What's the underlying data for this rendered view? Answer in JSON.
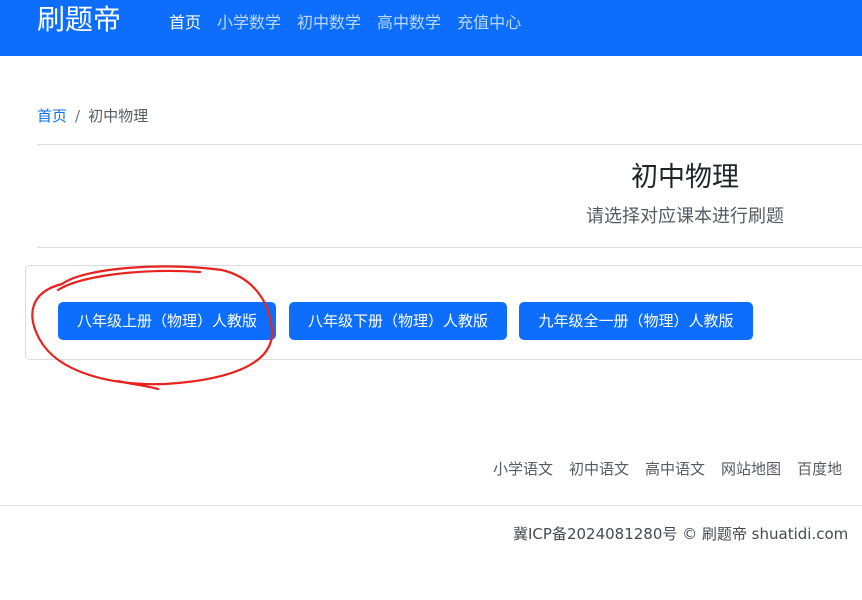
{
  "navbar": {
    "brand": "刷题帝",
    "links": [
      {
        "label": "首页",
        "active": true
      },
      {
        "label": "小学数学",
        "active": false
      },
      {
        "label": "初中数学",
        "active": false
      },
      {
        "label": "高中数学",
        "active": false
      },
      {
        "label": "充值中心",
        "active": false
      }
    ],
    "background": "#0d6efd"
  },
  "breadcrumb": {
    "home": "首页",
    "separator": "/",
    "current": "初中物理"
  },
  "header": {
    "title": "初中物理",
    "subtitle": "请选择对应课本进行刷题"
  },
  "textbooks": [
    {
      "label": "八年级上册（物理）人教版",
      "circled": true
    },
    {
      "label": "八年级下册（物理）人教版",
      "circled": false
    },
    {
      "label": "九年级全一册（物理）人教版",
      "circled": false
    }
  ],
  "annotation": {
    "color": "#e8231f",
    "shape": "hand-drawn circle around first textbook button"
  },
  "footer": {
    "links": [
      "小学语文",
      "初中语文",
      "高中语文",
      "网站地图",
      "百度地"
    ],
    "copyright": "冀ICP备2024081280号 © 刷题帝 shuatidi.com"
  },
  "colors": {
    "primary": "#0d6efd",
    "annotation_red": "#e8231f"
  }
}
